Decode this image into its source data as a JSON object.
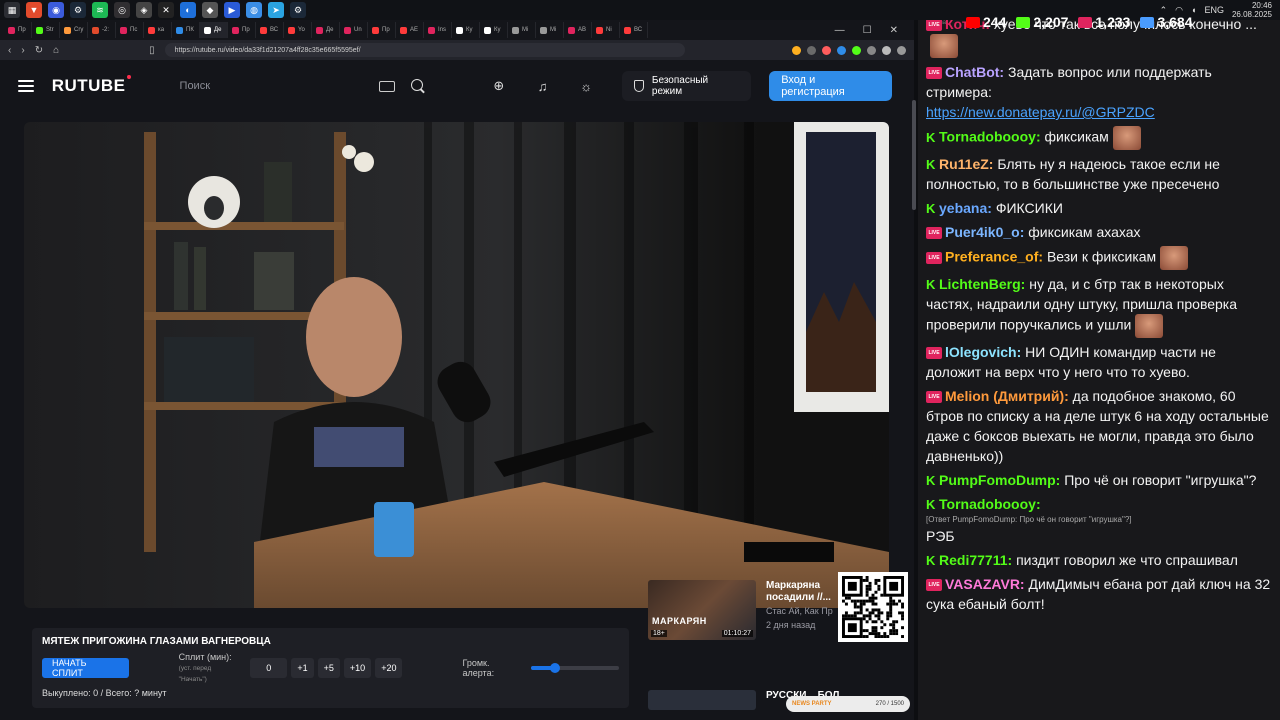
{
  "taskbar": {
    "time": "20:46",
    "date": "26.08.2025",
    "lang": "ENG"
  },
  "browser": {
    "tabs": [
      "Пр",
      "Str",
      "Cry",
      "-2:",
      "Пс",
      "ка",
      "ПК",
      "Де",
      "Пр",
      "ВС",
      "Yo",
      "Де",
      "Un",
      "Пр",
      "АЕ",
      "Ins",
      "Ку",
      "Ку",
      "Mi",
      "Mi",
      "АВ",
      "Ni",
      "ВС"
    ],
    "url": "https://rutube.ru/video/da33f1d21207a4ff28c35e665f5595ef/"
  },
  "rutube": {
    "logo": "RUTUBE",
    "search_placeholder": "Поиск",
    "safe_mode": "Безопасный режим",
    "login": "Вход и регистрация"
  },
  "split": {
    "title": "МЯТЕЖ ПРИГОЖИНА ГЛАЗАМИ ВАГНЕРОВЦА",
    "start_button": "НАЧАТЬ СПЛИТ",
    "split_label": "Сплит (мин):",
    "split_hint": "(уст. перед \"Начать\")",
    "minutes_value": "0",
    "steps": [
      "+1",
      "+5",
      "+10",
      "+20"
    ],
    "volume_label": "Громк. алерта:",
    "volume": 0.28,
    "status": "Выкуплено: 0 / Всего: ? минут"
  },
  "recommendation": {
    "title": "Маркаряна посадили //...",
    "channel": "Стас Ай, Как Пр",
    "date": "2 дня назад",
    "thumb_title": "МАРКАРЯН",
    "age": "18+",
    "duration": "01:10:27",
    "next_title": "РУССКИ... БОЛ..."
  },
  "party": {
    "label": "NEWS PARTY",
    "progress": "270 / 1500"
  },
  "chat": {
    "app": "AutChat",
    "stats": [
      {
        "icon": "youtube-icon",
        "value": "244",
        "color": "#ff0000"
      },
      {
        "icon": "kick-icon",
        "value": "2,207",
        "color": "#53fc18"
      },
      {
        "icon": "vk-live-icon",
        "value": "1,233",
        "color": "#e0245e"
      },
      {
        "icon": "viewers-icon",
        "value": "3,684",
        "color": "#4a9cff"
      }
    ],
    "messages": [
      {
        "platform": "live",
        "user": "Котич:",
        "color": "#e0245e",
        "text": "хуево что так все получилось конечно ...",
        "emote": true
      },
      {
        "platform": "live",
        "user": "ChatBot:",
        "color": "#b9a3ff",
        "text": "Задать вопрос или поддержать стримера:",
        "link": "https://new.donatepay.ru/@GRPZDC"
      },
      {
        "platform": "kick",
        "user": "Tornadobooоy:",
        "color": "#53fc18",
        "text": "фиксикам",
        "emote": true
      },
      {
        "platform": "kick",
        "user": "Ru11eZ:",
        "color": "#ffb46b",
        "text": "Блять ну я надеюсь такое если не полностью, то в большинстве уже пресечено"
      },
      {
        "platform": "kick",
        "user": "yebana:",
        "color": "#6aa8ff",
        "text": "ФИКСИКИ"
      },
      {
        "platform": "live",
        "user": "Puer4ik0_o:",
        "color": "#7cb6ff",
        "text": "фиксикам ахахах"
      },
      {
        "platform": "live",
        "user": "Preferance_of:",
        "color": "#ffb020",
        "text": "Вези к фиксикам",
        "emote": true
      },
      {
        "platform": "kick",
        "user": "LichtenBerg:",
        "color": "#53fc18",
        "text": "ну да, и с бтр так в некоторых частях, надраили одну штуку, пришла проверка проверили поручкались и ушли",
        "emote": true
      },
      {
        "platform": "live",
        "user": "lOlegovich:",
        "color": "#8de3ff",
        "text": "НИ ОДИН командир части не доложит на верх что у него что то хуево."
      },
      {
        "platform": "live",
        "user": "Melion (Дмитрий):",
        "color": "#ff9a3c",
        "text": "да подобное знакомо, 60 бтров по списку а на деле штук 6 на ходу остальные даже с боксов выехать не могли, правда это было давненько))"
      },
      {
        "platform": "kick",
        "user": "PumpFomoDump:",
        "color": "#53fc18",
        "text": "Про чё он говорит \"игрушка\"?"
      },
      {
        "platform": "kick",
        "user": "Tornadobooоy:",
        "color": "#53fc18",
        "reply": "[Ответ PumpFomoDump: Про чё он говорит \"игрушка\"?]",
        "text": "РЭБ"
      },
      {
        "platform": "kick",
        "user": "Redi77711:",
        "color": "#53fc18",
        "text": "пиздит говорил же что спрашивал"
      },
      {
        "platform": "live",
        "user": "VASAZAVR:",
        "color": "#ff7ad9",
        "text": "ДимДимыч ебана рот дай ключ на 32 сука ебаный болт!"
      }
    ]
  },
  "colors": {
    "accent": "#2f8ce8",
    "kick": "#53fc18",
    "live": "#e0245e"
  }
}
